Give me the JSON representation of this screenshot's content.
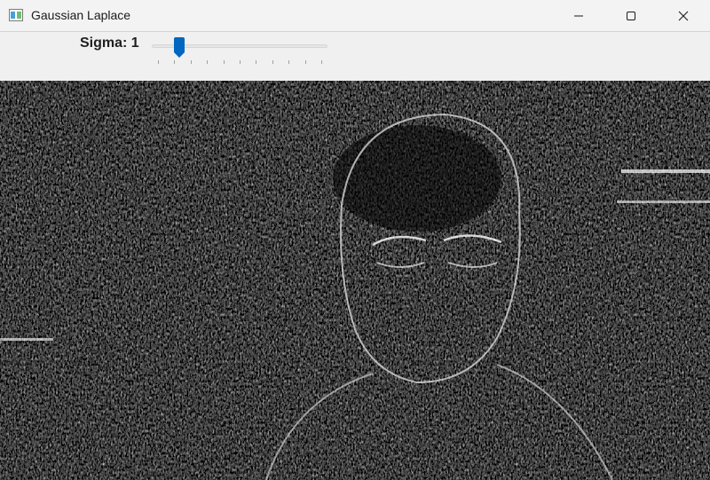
{
  "window": {
    "title": "Gaussian Laplace",
    "icon": "app-window-icon",
    "controls": [
      "minimize-icon",
      "maximize-icon",
      "close-icon"
    ]
  },
  "trackbar": {
    "label": "Sigma: 1",
    "value": 1,
    "tick_count": 11
  },
  "image": {
    "description_icon": "edge-filtered-image",
    "background": "#000000",
    "foreground": "#ffffff"
  }
}
